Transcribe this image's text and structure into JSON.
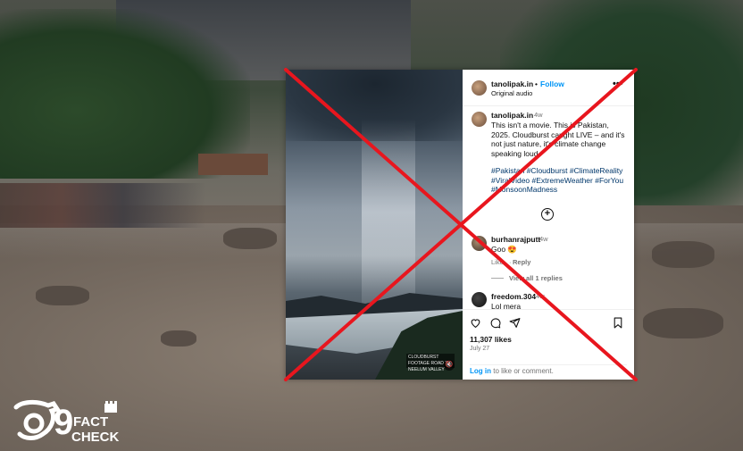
{
  "post": {
    "username": "tanolipak.in",
    "follow_label": "Follow",
    "dot": "•",
    "audio": "Original audio",
    "more_label": "•••",
    "caption": {
      "username": "tanolipak.in",
      "time_ago": "4w",
      "text": "This isn't a movie. This is Pakistan, 2025. Cloudburst caught LIVE – and it's not just nature, it's climate change speaking loud.",
      "hashtags": "#Pakistan #Cloudburst #ClimateReality #ViralVideo #ExtremeWeather #ForYou #MonsoonMadness"
    },
    "load_more_label": "+",
    "comments": [
      {
        "username": "burhanrajputt",
        "time_ago": "4w",
        "text": "Goo 😍",
        "like_label": "Like",
        "separator": "·",
        "reply_label": "Reply",
        "view_replies": "View all 1 replies"
      },
      {
        "username": "freedom.304",
        "time_ago": "4w",
        "text": "Lol mera"
      }
    ],
    "likes": "11,307 likes",
    "date": "July 27",
    "login_link": "Log in",
    "login_text": " to like or comment.",
    "video_overlay_text": "CLOUDBURST FOOTAGE ROAD TO NEELUM VALLEY"
  },
  "icons": {
    "heart": "heart-icon",
    "comment": "comment-icon",
    "share": "share-icon",
    "save": "bookmark-icon",
    "mute": "mute-icon"
  },
  "overlay": {
    "x_color": "#e8161e",
    "meaning": "false"
  },
  "logo": {
    "number": "9",
    "fact": "FACT",
    "check": "CHECK"
  },
  "colors": {
    "link": "#0095f6",
    "hashtag": "#00376b"
  }
}
